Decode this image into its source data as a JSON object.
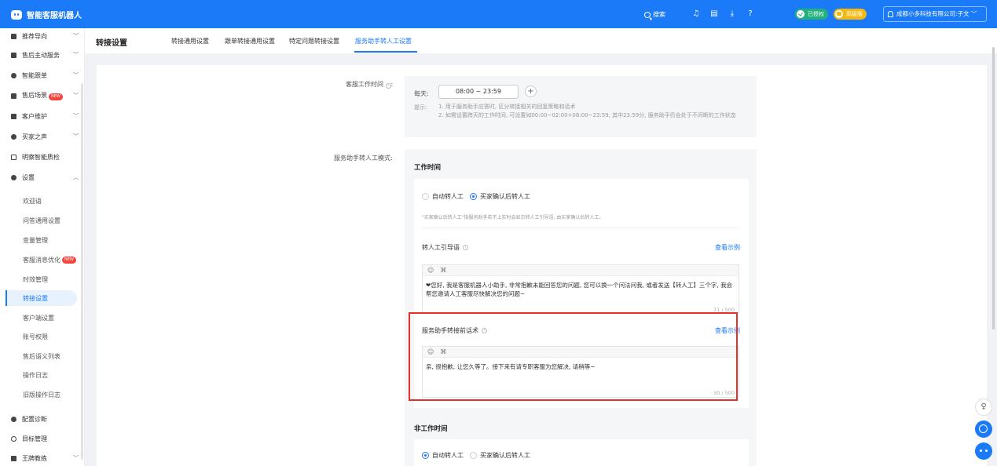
{
  "app": {
    "title": "智能客服机器人"
  },
  "topbar": {
    "search_label": "搜索",
    "auth_badge": "已授权",
    "pro_badge": "高级版",
    "company": "成都小多科技有限公司:子文"
  },
  "sidebar": {
    "items": [
      {
        "label": "推荐导向",
        "chevron": "﹀"
      },
      {
        "label": "售后主动服务",
        "chevron": "﹀"
      },
      {
        "label": "智能跟单",
        "chevron": "﹀"
      },
      {
        "label": "售后场景",
        "tag": "NEW",
        "chevron": "﹀"
      },
      {
        "label": "客户维护",
        "chevron": "﹀"
      },
      {
        "label": "买家之声",
        "chevron": "﹀"
      },
      {
        "label": "明察智能质检"
      },
      {
        "label": "设置",
        "chevron": "︿"
      }
    ],
    "sub_items": [
      {
        "label": "欢迎语"
      },
      {
        "label": "问答通用设置"
      },
      {
        "label": "变量管理"
      },
      {
        "label": "客服消息优化",
        "tag": "NEW"
      },
      {
        "label": "时效管理"
      },
      {
        "label": "转接设置"
      },
      {
        "label": "客户端设置"
      },
      {
        "label": "账号权限"
      },
      {
        "label": "售后语义列表"
      },
      {
        "label": "操作日志"
      },
      {
        "label": "旧版操作日志"
      }
    ],
    "bottom_items": [
      {
        "label": "配置诊断"
      },
      {
        "label": "目标管理"
      },
      {
        "label": "王牌教练",
        "chevron": "﹀"
      }
    ]
  },
  "page": {
    "title": "转接设置"
  },
  "tabs": [
    "转接通用设置",
    "跟单转接通用设置",
    "特定问题转接设置",
    "服务助手转人工设置"
  ],
  "form": {
    "work_time_label": "客服工作时间",
    "every_day": "每天:",
    "time_range": "08:00  ~  23:59",
    "add": "+",
    "tip_label": "提示:",
    "tip1": "1. 用于服务助手应答时, 区分转接相关的回复策略和话术",
    "tip2": "2. 如需设置跨天的工作时间, 可设置如00:00~02:00+08:00~23:59, 其中23:59分, 服务助手仍会处于不间断的工作状态",
    "mode_label": "服务助手转人工模式:",
    "work_section": "工作时间",
    "opt_auto": "自动转人工",
    "opt_confirm": "买家确认后转人工",
    "note": "\"买家确认后转人工\"指服务助手若不上实时会显示转人工引导语, 由买家确认后转人工。",
    "guide_label": "转人工引导语",
    "view_example": "查看示例",
    "guide_text": "❤您好, 我是客服机器人小助手, 非常抱歉未能回答您的问题, 您可以换一个问法问我, 或者发送【转人工】三个字, 我会帮您邀请人工客服尽快解决您的问题~",
    "guide_count": "71 / 500",
    "pre_label": "服务助手转接前话术",
    "pre_text": "亲, 很抱歉, 让您久等了。接下来有请专职客服为您解决, 请稍等~",
    "pre_count": "30 / 500",
    "nonwork_section": "非工作时间",
    "emoji_btn": "☺",
    "var_btn": "⌘"
  },
  "colors": {
    "primary": "#1a7af8",
    "highlight": "#e6302a",
    "auth": "#22b07d",
    "pro": "#f4b90f"
  }
}
